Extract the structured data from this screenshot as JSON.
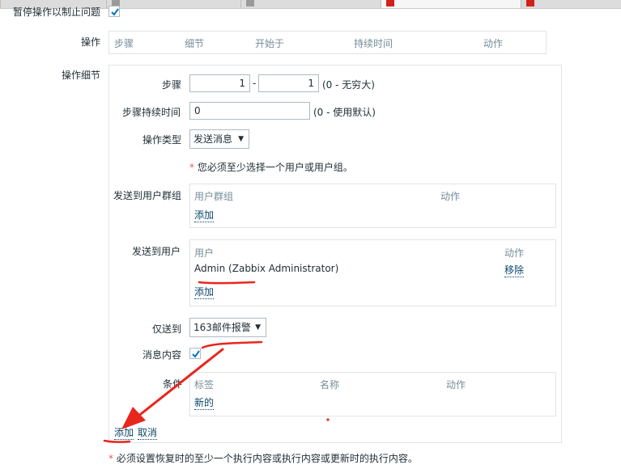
{
  "colors": {
    "accent_link": "#0a466a",
    "checkbox_check": "#0275b8",
    "annotation_red": "#e8261d",
    "required": "#e45959"
  },
  "top": {
    "pause_label": "暂停操作以制止问题",
    "pause_checked": true
  },
  "operations": {
    "label": "操作",
    "headers": [
      "步骤",
      "细节",
      "开始于",
      "持续时间",
      "动作"
    ]
  },
  "details": {
    "label": "操作细节",
    "steps": {
      "label": "步骤",
      "from": "1",
      "sep": "-",
      "to": "1",
      "hint": "(0 - 无穷大)"
    },
    "step_duration": {
      "label": "步骤持续时间",
      "value": "0",
      "hint": "(0 - 使用默认)"
    },
    "op_type": {
      "label": "操作类型",
      "value": "发送消息",
      "icon": "triangle-down"
    },
    "warning": "您必须至少选择一个用户或用户组。",
    "user_groups": {
      "label": "发送到用户群组",
      "col_group": "用户群组",
      "col_action": "动作",
      "add": "添加"
    },
    "users": {
      "label": "发送到用户",
      "col_user": "用户",
      "col_action": "动作",
      "rows": [
        {
          "name": "Admin (Zabbix Administrator)",
          "action": "移除"
        }
      ],
      "add": "添加"
    },
    "send_only": {
      "label": "仅送到",
      "value": "163邮件报警",
      "icon": "triangle-down"
    },
    "message": {
      "label": "消息内容",
      "checked": true
    },
    "conditions": {
      "label": "条件",
      "col_tag": "标签",
      "col_name": "名称",
      "col_action": "动作",
      "new": "新的"
    },
    "add_button": "添加",
    "cancel_button": "取消"
  },
  "footer_note": "必须设置恢复时的至少一个执行内容或执行内容或更新时的执行内容。"
}
